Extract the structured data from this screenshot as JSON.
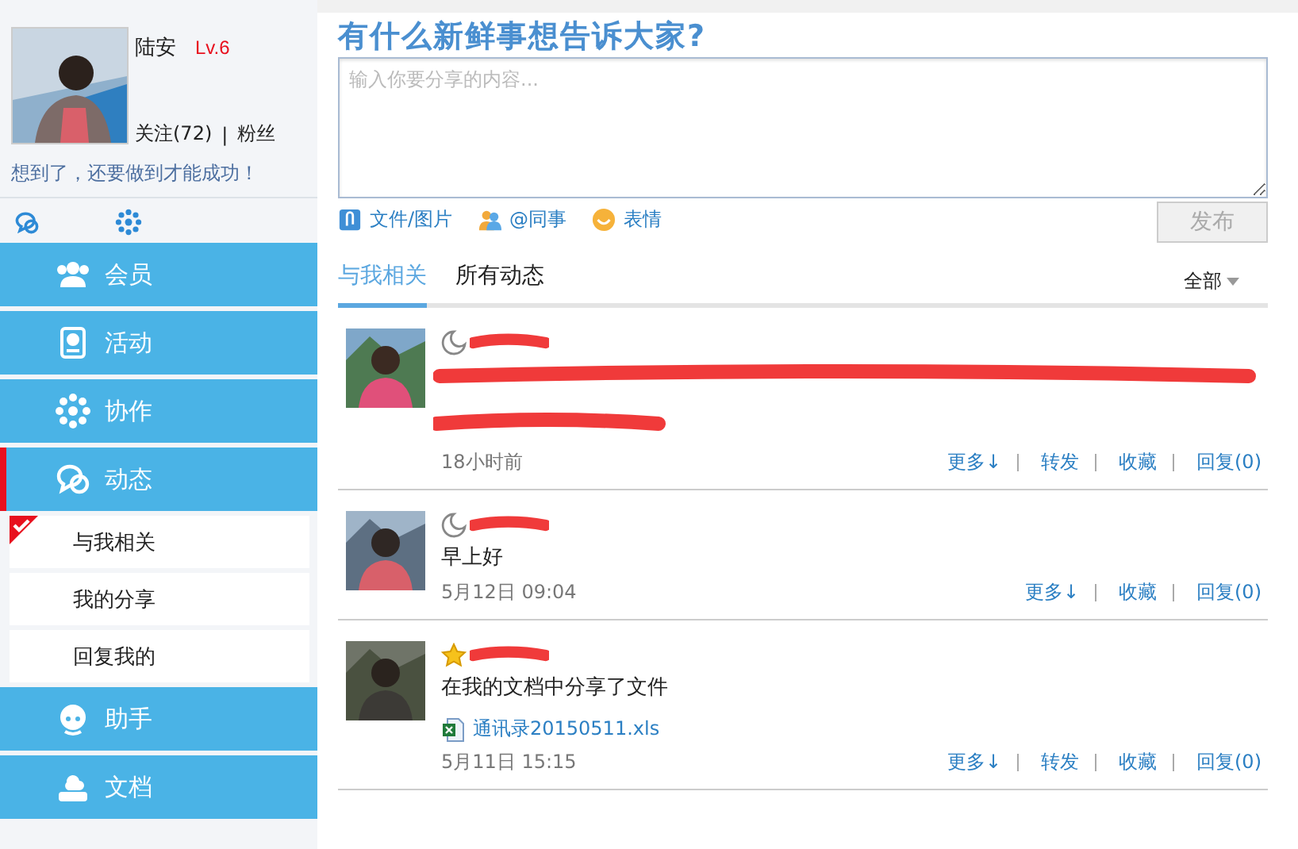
{
  "profile": {
    "name": "陆安",
    "level": "Lv.6",
    "following": "关注(72)",
    "separator": "|",
    "followers": "粉丝",
    "motto": "想到了，还要做到才能成功！"
  },
  "nav": [
    {
      "label": "会员",
      "selected": false
    },
    {
      "label": "活动",
      "selected": false
    },
    {
      "label": "协作",
      "selected": false
    },
    {
      "label": "动态",
      "selected": true,
      "children": [
        {
          "label": "与我相关",
          "selected": true
        },
        {
          "label": "我的分享",
          "selected": false
        },
        {
          "label": "回复我的",
          "selected": false
        }
      ]
    },
    {
      "label": "助手",
      "selected": false
    },
    {
      "label": "文档",
      "selected": false
    }
  ],
  "composer": {
    "title": "有什么新鲜事想告诉大家?",
    "placeholder": "输入你要分享的内容...",
    "tools": [
      "文件/图片",
      "@同事",
      "表情"
    ],
    "submit": {
      "label": "发布",
      "disabled": true
    }
  },
  "tabs": [
    {
      "label": "与我相关",
      "selected": true
    },
    {
      "label": "所有动态",
      "selected": false
    }
  ],
  "filter": "全部",
  "posts": [
    {
      "kind": "moon",
      "body_redacted": true,
      "time": "18小时前",
      "actions": [
        "更多↓",
        "转发",
        "收藏",
        "回复(0)"
      ]
    },
    {
      "kind": "moon",
      "body": "早上好",
      "time": "5月12日 09:04",
      "actions": [
        "更多↓",
        "收藏",
        "回复(0)"
      ]
    },
    {
      "kind": "star",
      "body": "在我的文档中分享了文件",
      "file": "通讯录20150511.xls",
      "time": "5月11日 15:15",
      "actions": [
        "更多↓",
        "转发",
        "收藏",
        "回复(0)"
      ]
    }
  ]
}
